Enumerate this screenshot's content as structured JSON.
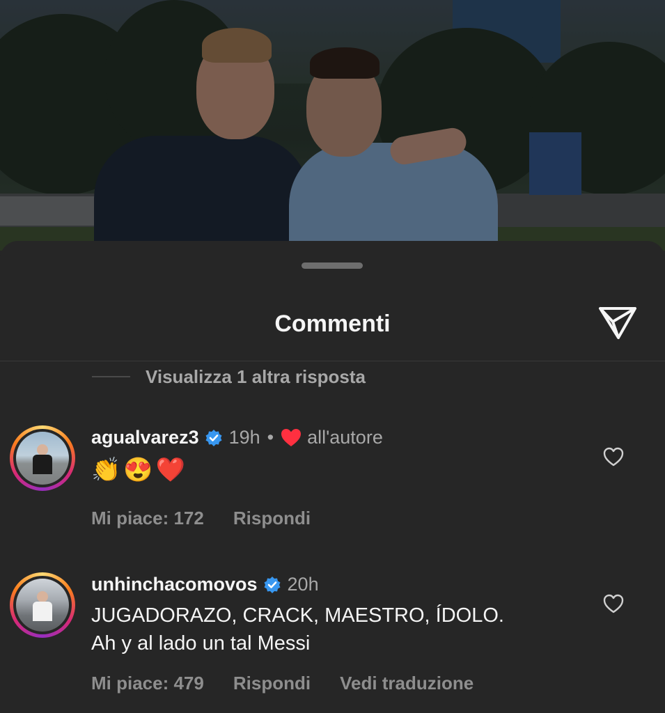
{
  "header": {
    "title": "Commenti",
    "share_icon": "paper-plane-icon"
  },
  "more_replies": {
    "label": "Visualizza 1 altra risposta"
  },
  "comments": [
    {
      "username": "agualvarez3",
      "verified": true,
      "time": "19h",
      "separator": "•",
      "liked_by_author": "all'autore",
      "text": "👏😍❤️",
      "likes_label": "Mi piace: 172",
      "reply_label": "Rispondi"
    },
    {
      "username": "unhinchacomovos",
      "verified": true,
      "time": "20h",
      "text_line1": "JUGADORAZO, CRACK, MAESTRO, ÍDOLO.",
      "text_line2": "Ah y al lado un tal Messi",
      "likes_label": "Mi piace: 479",
      "reply_label": "Rispondi",
      "translate_label": "Vedi traduzione"
    }
  ],
  "colors": {
    "sheet_bg": "#262626",
    "text": "#f5f5f5",
    "muted": "#a8a8a8",
    "verified": "#3897f0",
    "heart": "#ff3040"
  }
}
